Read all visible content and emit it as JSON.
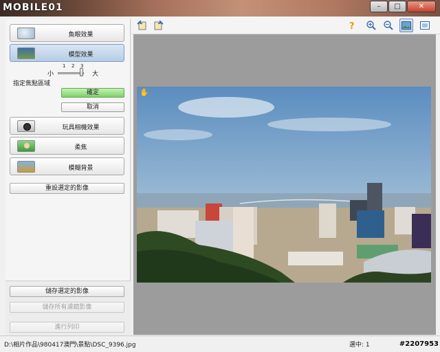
{
  "app": {
    "logo_text": "MOBILE01"
  },
  "window": {
    "minimize": "–",
    "maximize": "□",
    "close": "✕"
  },
  "effects": {
    "fisheye": {
      "label": "魚眼效果",
      "icon": "fisheye-icon"
    },
    "model": {
      "label": "模型效果",
      "icon": "model-icon"
    },
    "toy_camera": {
      "label": "玩具相機效果",
      "icon": "camera-icon"
    },
    "soft_focus": {
      "label": "柔焦",
      "icon": "person-icon"
    },
    "blur_bg": {
      "label": "模糊背景",
      "icon": "landscape-icon"
    }
  },
  "focus": {
    "slider_small": "小",
    "slider_big": "大",
    "ticks": [
      "1",
      "2",
      "3"
    ],
    "value": 3,
    "label": "指定焦點區域",
    "ok": "確定",
    "cancel": "取消"
  },
  "reset_button": "重設選定的影像",
  "save_selected": "儲存選定的影像",
  "save_all": "儲存所有濾鏡影像",
  "print": "進行列印",
  "status": {
    "path": "D:\\相片作品\\980417澳門\\景點\\DSC_9396.jpg",
    "selected": "選中: 1",
    "watermark": "#2207953"
  },
  "toolbar": {
    "icons": [
      "rotate-left-icon",
      "rotate-right-icon",
      "help-icon",
      "zoom-in-icon",
      "zoom-out-icon",
      "fit-view-icon",
      "full-view-icon"
    ]
  },
  "colors": {
    "ok_green": "#7ed16a",
    "active_blue": "#b7cde4"
  }
}
